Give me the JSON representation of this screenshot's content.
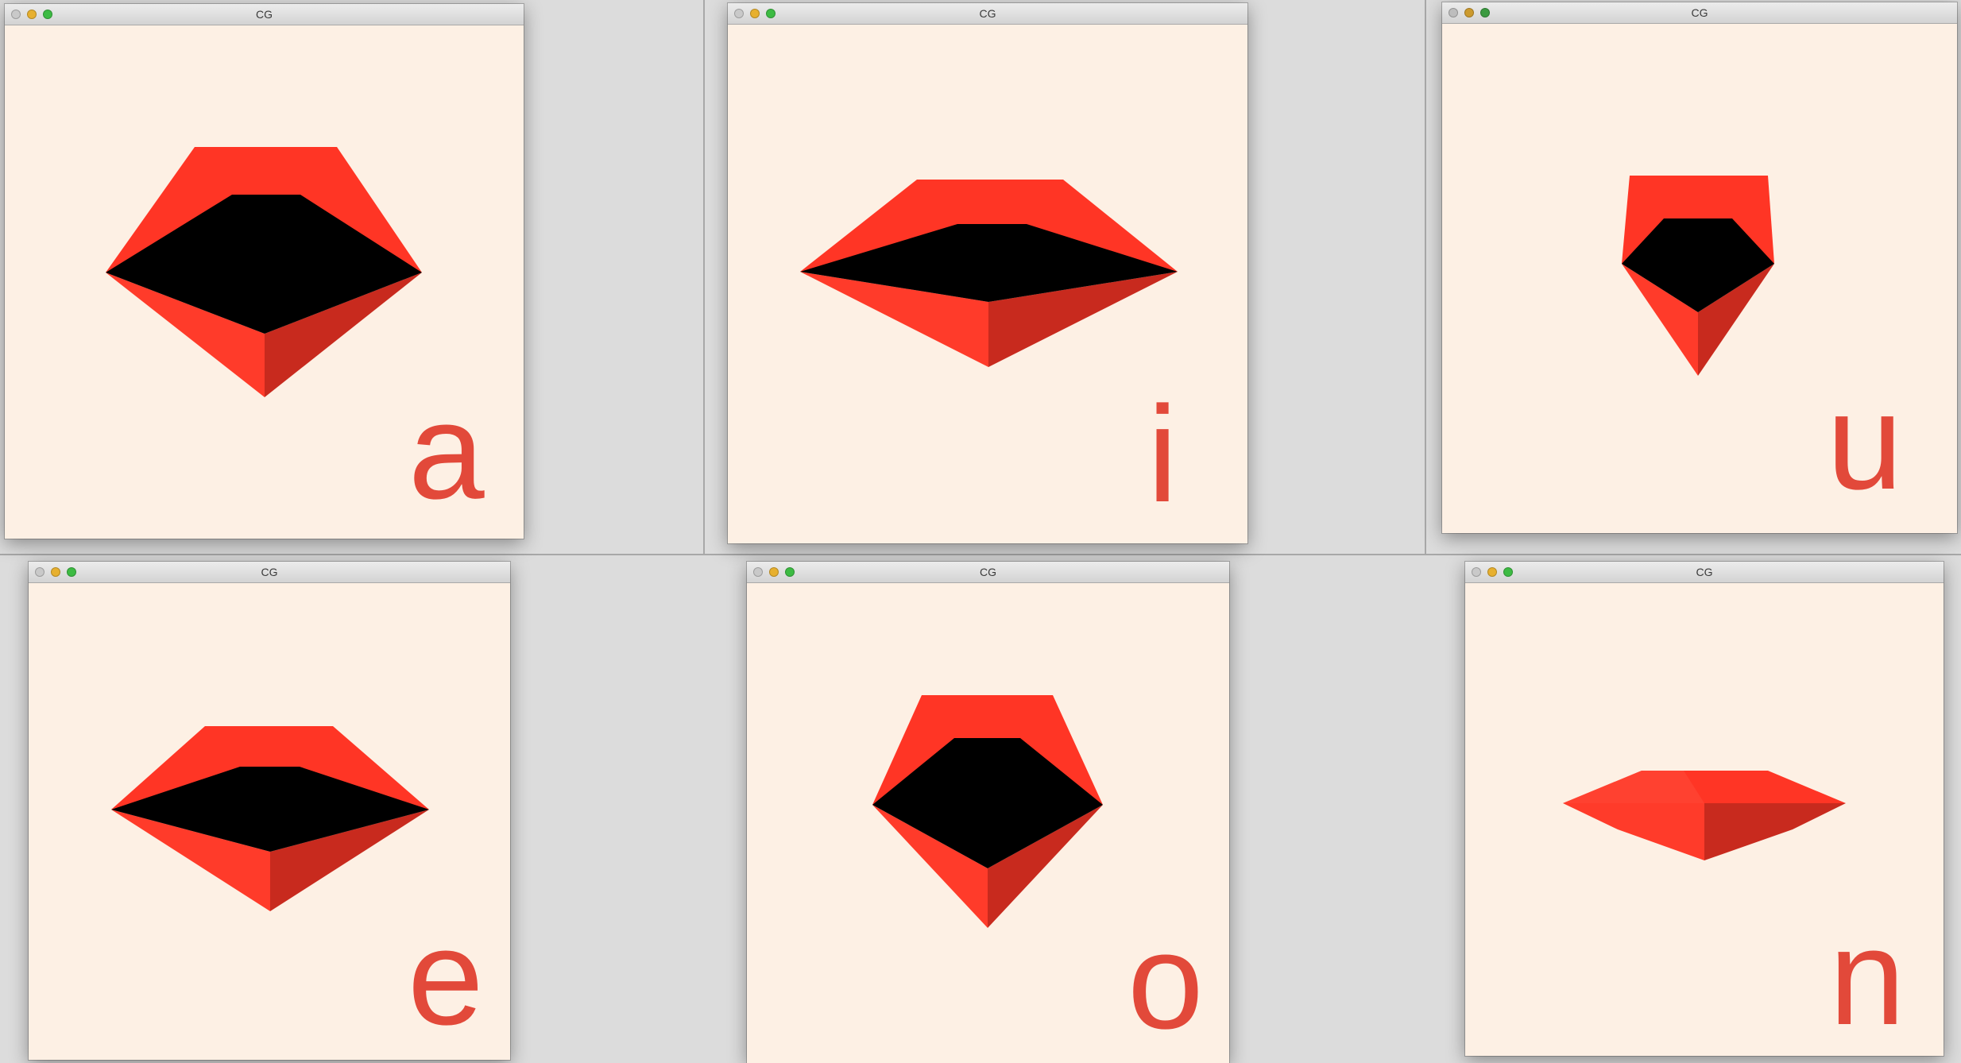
{
  "windows": [
    {
      "id": "a",
      "title": "CG",
      "letter": "a"
    },
    {
      "id": "i",
      "title": "CG",
      "letter": "i"
    },
    {
      "id": "u",
      "title": "CG",
      "letter": "u"
    },
    {
      "id": "e",
      "title": "CG",
      "letter": "e"
    },
    {
      "id": "o",
      "title": "CG",
      "letter": "o"
    },
    {
      "id": "n",
      "title": "CG",
      "letter": "n"
    }
  ],
  "colors": {
    "canvas": "#fdf0e4",
    "lip": "#ff3a2a",
    "lip_shadow": "#c8281e",
    "mouth_interior": "#000000",
    "letter": "#e2493a"
  }
}
